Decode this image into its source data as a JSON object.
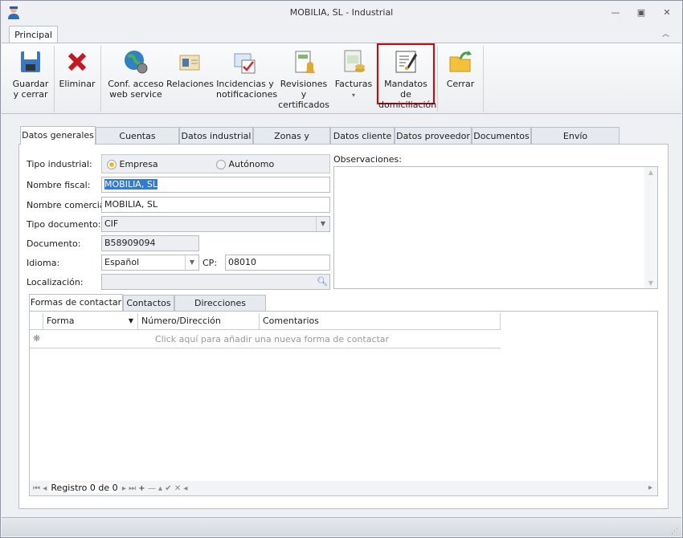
{
  "window": {
    "title": "MOBILIA, SL - Industrial"
  },
  "ribbon": {
    "tab": "Principal",
    "buttons": [
      {
        "line1": "Guardar",
        "line2": "y cerrar"
      },
      {
        "line1": "Eliminar",
        "line2": ""
      },
      {
        "line1": "Conf. acceso",
        "line2": "web service"
      },
      {
        "line1": "Relaciones",
        "line2": ""
      },
      {
        "line1": "Incidencias y",
        "line2": "notificaciones"
      },
      {
        "line1": "Revisiones y",
        "line2": "certificados"
      },
      {
        "line1": "Facturas",
        "line2": "▾"
      },
      {
        "line1": "Mandatos de",
        "line2": "domiciliación"
      },
      {
        "line1": "Cerrar",
        "line2": ""
      }
    ]
  },
  "tabs": [
    "Datos generales",
    "Cuentas bancarias",
    "Datos industrial",
    "Zonas y servicios",
    "Datos cliente",
    "Datos proveedor",
    "Documentos",
    "Envío notificaciones"
  ],
  "form": {
    "tipo_industrial_label": "Tipo industrial:",
    "opt_empresa": "Empresa",
    "opt_autonomo": "Autónomo",
    "nombre_fiscal_label": "Nombre fiscal:",
    "nombre_fiscal": "MOBILIA, SL",
    "nombre_comercial_label": "Nombre comercial:",
    "nombre_comercial": "MOBILIA, SL",
    "tipo_documento_label": "Tipo documento:",
    "tipo_documento": "CIF",
    "documento_label": "Documento:",
    "documento": "B58909094",
    "idioma_label": "Idioma:",
    "idioma": "Español",
    "cp_label": "CP:",
    "cp": "08010",
    "localizacion_label": "Localización:",
    "localizacion": "",
    "observaciones_label": "Observaciones:"
  },
  "subtabs": [
    "Formas de contactar",
    "Contactos",
    "Direcciones postales"
  ],
  "grid": {
    "columns": [
      "Forma",
      "Número/Dirección",
      "Comentarios"
    ],
    "new_row_text": "Click aquí para añadir una nueva forma de contactar",
    "navigator": "Registro 0 de 0"
  }
}
